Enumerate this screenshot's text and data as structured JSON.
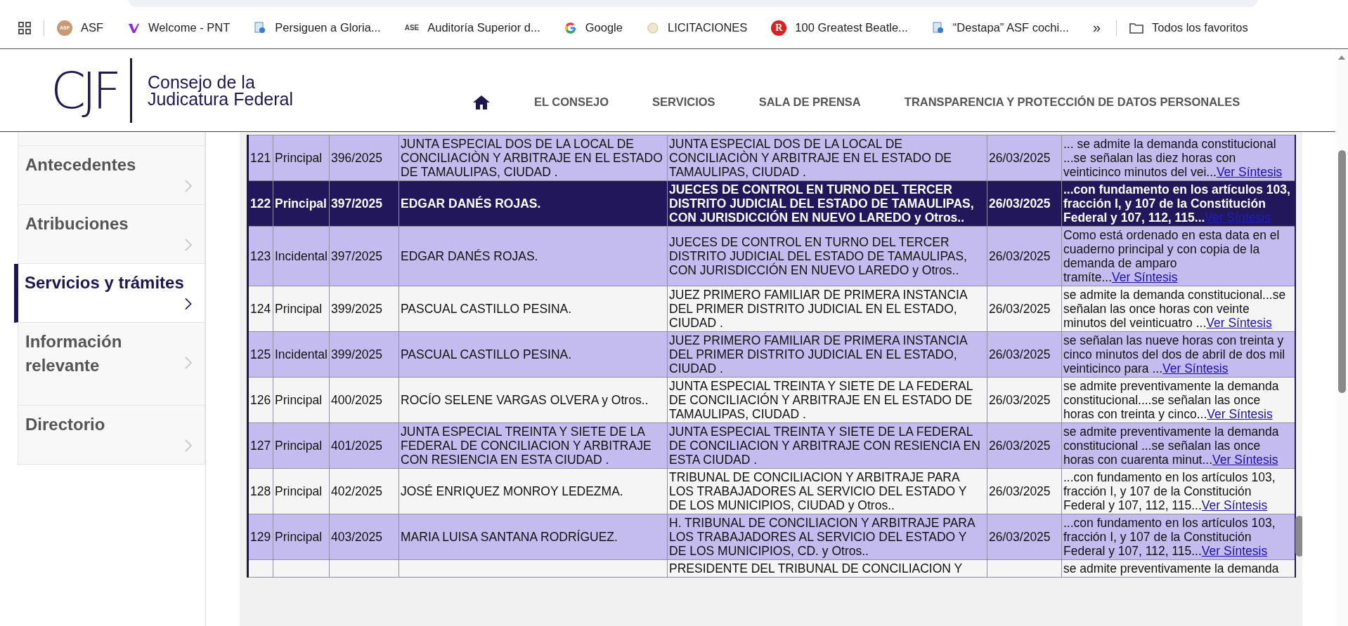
{
  "browser": {
    "bookmarks": [
      {
        "label": "ASF",
        "kind": "badge",
        "favicon_text": "ASF"
      },
      {
        "label": "Welcome - PNT",
        "kind": "ribbon"
      },
      {
        "label": "Persiguen a Gloria...",
        "kind": "doc"
      },
      {
        "label": "Auditoría Superior d...",
        "kind": "text",
        "favicon_text": "ASE"
      },
      {
        "label": "Google",
        "kind": "g"
      },
      {
        "label": "LICITACIONES",
        "kind": "seal"
      },
      {
        "label": "100 Greatest Beatle...",
        "kind": "badgered",
        "favicon_text": "R"
      },
      {
        "label": "“Destapa” ASF cochi...",
        "kind": "doc"
      }
    ],
    "overflow": "»",
    "all_bookmarks": "Todos los favoritos"
  },
  "header": {
    "logo_text": "CJF",
    "org_name_lines": [
      "Consejo de la",
      "Judicatura Federal"
    ],
    "nav": [
      "EL CONSEJO",
      "SERVICIOS",
      "SALA DE PRENSA",
      "TRANSPARENCIA Y PROTECCIÓN DE DATOS PERSONALES"
    ]
  },
  "sidebar": {
    "items": [
      {
        "label": "Antecedentes",
        "selected": false
      },
      {
        "label": "Atribuciones",
        "selected": false
      },
      {
        "label": "Servicios y trámites",
        "selected": true
      },
      {
        "label": "Información relevante",
        "selected": false
      },
      {
        "label": "Directorio",
        "selected": false
      }
    ]
  },
  "table": {
    "rows": [
      {
        "number": "121",
        "type": "Principal",
        "file": "396/2025",
        "party": "JUNTA ESPECIAL DOS DE LA LOCAL DE CONCILIACIÒN Y ARBITRAJE EN EL ESTADO DE TAMAULIPAS, CIUDAD .",
        "authority": "JUNTA ESPECIAL DOS DE LA LOCAL DE CONCILIACIÒN Y ARBITRAJE EN EL ESTADO DE TAMAULIPAS, CIUDAD .",
        "date": "26/03/2025",
        "summary": "... se admite la demanda constitucional ...se señalan las diez horas con veinticinco minutos del vei...",
        "link": "Ver Síntesis",
        "selected": false
      },
      {
        "number": "122",
        "type": "Principal",
        "file": "397/2025",
        "party": "EDGAR DANÉS ROJAS.",
        "authority": "JUECES DE CONTROL EN TURNO DEL TERCER DISTRITO JUDICIAL DEL ESTADO DE TAMAULIPAS, CON JURISDICCIÓN EN NUEVO LAREDO y Otros..",
        "date": "26/03/2025",
        "summary": "...con fundamento en los artículos 103, fracción I, y 107 de la Constitución Federal y 107, 112, 115...",
        "link": "Ver Síntesis",
        "selected": true
      },
      {
        "number": "123",
        "type": "Incidental",
        "file": "397/2025",
        "party": "EDGAR DANÉS ROJAS.",
        "authority": "JUECES DE CONTROL EN TURNO DEL TERCER DISTRITO JUDICIAL DEL ESTADO DE TAMAULIPAS, CON JURISDICCIÓN EN NUEVO LAREDO y Otros..",
        "date": "26/03/2025",
        "summary": "Como está ordenado en esta data en el cuaderno principal y con copia de la demanda de amparo tramíte...",
        "link": "Ver Síntesis",
        "selected": false
      },
      {
        "number": "124",
        "type": "Principal",
        "file": "399/2025",
        "party": "PASCUAL CASTILLO PESINA.",
        "authority": "JUEZ PRIMERO FAMILIAR DE PRIMERA INSTANCIA DEL PRIMER DISTRITO JUDICIAL EN EL ESTADO, CIUDAD .",
        "date": "26/03/2025",
        "summary": "se admite la demanda constitucional...se señalan las once horas con veinte minutos del veinticuatro ...",
        "link": "Ver Síntesis",
        "selected": false
      },
      {
        "number": "125",
        "type": "Incidental",
        "file": "399/2025",
        "party": "PASCUAL CASTILLO PESINA.",
        "authority": "JUEZ PRIMERO FAMILIAR DE PRIMERA INSTANCIA DEL PRIMER DISTRITO JUDICIAL EN EL ESTADO, CIUDAD .",
        "date": "26/03/2025",
        "summary": "se señalan las nueve horas con treinta y cinco minutos del dos de abril de dos mil veinticinco para ...",
        "link": "Ver Síntesis",
        "selected": false
      },
      {
        "number": "126",
        "type": "Principal",
        "file": "400/2025",
        "party": "ROCÍO SELENE VARGAS OLVERA y Otros..",
        "authority": "JUNTA ESPECIAL TREINTA Y SIETE DE LA FEDERAL DE CONCILIACIÓN Y ARBITRAJE EN EL ESTADO DE TAMAULIPAS, CIUDAD .",
        "date": "26/03/2025",
        "summary": "se admite preventivamente la demanda constitucional....se señalan las once horas con treinta y cinco...",
        "link": "Ver Síntesis",
        "selected": false
      },
      {
        "number": "127",
        "type": "Principal",
        "file": "401/2025",
        "party": "JUNTA ESPECIAL TREINTA Y SIETE DE LA FEDERAL DE CONCILIACION Y ARBITRAJE CON RESIENCIA EN ESTA CIUDAD .",
        "authority": "JUNTA ESPECIAL TREINTA Y SIETE DE LA FEDERAL DE CONCILIACION Y ARBITRAJE CON RESIENCIA EN ESTA CIUDAD .",
        "date": "26/03/2025",
        "summary": "se admite preventivamente la demanda constitucional ...se señalan las once horas con cuarenta minut...",
        "link": "Ver Síntesis",
        "selected": false
      },
      {
        "number": "128",
        "type": "Principal",
        "file": "402/2025",
        "party": "JOSÉ ENRIQUEZ MONROY LEDEZMA.",
        "authority": "TRIBUNAL DE CONCILIACION Y ARBITRAJE PARA LOS TRABAJADORES AL SERVICIO DEL ESTADO Y DE LOS MUNICIPIOS, CIUDAD y Otros..",
        "date": "26/03/2025",
        "summary": "...con fundamento en los artículos 103, fracción I, y 107 de la Constitución Federal y 107, 112, 115...",
        "link": "Ver Síntesis",
        "selected": false
      },
      {
        "number": "129",
        "type": "Principal",
        "file": "403/2025",
        "party": "MARIA LUISA SANTANA RODRÍGUEZ.",
        "authority": "H. TRIBUNAL DE CONCILIACION Y ARBITRAJE PARA LOS TRABAJADORES AL SERVICIO DEL ESTADO Y DE LOS MUNICIPIOS, CD. y Otros..",
        "date": "26/03/2025",
        "summary": "...con fundamento en los artículos 103, fracción I, y 107 de la Constitución Federal y 107, 112, 115...",
        "link": "Ver Síntesis",
        "selected": false
      },
      {
        "authority": "PRESIDENTE DEL TRIBUNAL DE CONCILIACION Y",
        "summary": "se admite preventivamente la demanda",
        "selected": false
      }
    ]
  }
}
